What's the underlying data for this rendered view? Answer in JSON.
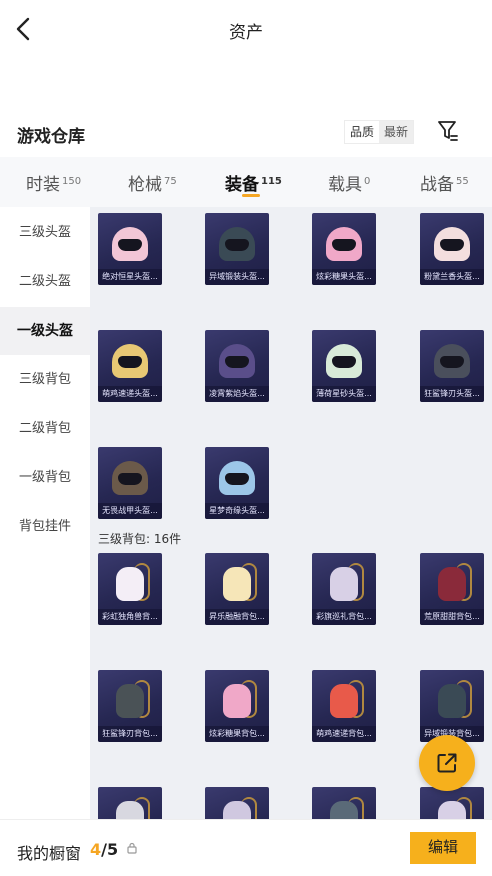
{
  "header": {
    "title": "资产"
  },
  "warehouse": {
    "title": "游戏仓库",
    "sort_options": [
      "品质",
      "最新"
    ]
  },
  "tabs": [
    {
      "label": "时装",
      "count": "150"
    },
    {
      "label": "枪械",
      "count": "75"
    },
    {
      "label": "装备",
      "count": "115"
    },
    {
      "label": "载具",
      "count": "0"
    },
    {
      "label": "战备",
      "count": "55"
    }
  ],
  "sidebar": [
    {
      "label": "三级头盔"
    },
    {
      "label": "二级头盔"
    },
    {
      "label": "一级头盔"
    },
    {
      "label": "三级背包"
    },
    {
      "label": "二级背包"
    },
    {
      "label": "一级背包"
    },
    {
      "label": "背包挂件"
    }
  ],
  "helmets": [
    {
      "name": "绝对恒星头盔...",
      "color": "#f2c6d6"
    },
    {
      "name": "异域锻装头盔...",
      "color": "#3a4a55"
    },
    {
      "name": "炫彩糖果头盔...",
      "color": "#f0a8c8"
    },
    {
      "name": "粉黛兰香头盔...",
      "color": "#f3dede"
    },
    {
      "name": "萌鸡速递头盔...",
      "color": "#e8c874"
    },
    {
      "name": "凌霄紫焰头盔...",
      "color": "#5a4e8a"
    },
    {
      "name": "薄荷星砂头盔...",
      "color": "#d8ead8"
    },
    {
      "name": "狂鲨锋刃头盔...",
      "color": "#4a4f5c"
    },
    {
      "name": "无畏战甲头盔...",
      "color": "#6b5a4a"
    },
    {
      "name": "星梦奇缘头盔...",
      "color": "#9cc6e8"
    }
  ],
  "backpack_section": {
    "label": "三级背包: 16件"
  },
  "backpacks": [
    {
      "name": "彩虹独角兽背...",
      "color": "#f4eef6"
    },
    {
      "name": "昇乐融融背包...",
      "color": "#f6e6b8"
    },
    {
      "name": "彩旗巡礼背包...",
      "color": "#d8d0e6"
    },
    {
      "name": "荒原甜甜背包...",
      "color": "#8a2a3a"
    },
    {
      "name": "狂鲨锋刃背包...",
      "color": "#4a5256"
    },
    {
      "name": "炫彩糖果背包...",
      "color": "#f0a8c8"
    },
    {
      "name": "萌鸡速递背包...",
      "color": "#e85a4a"
    },
    {
      "name": "异域锻装背包...",
      "color": "#3a4a55"
    },
    {
      "name": "",
      "color": "#d8d8e0"
    },
    {
      "name": "",
      "color": "#d0c8e0"
    },
    {
      "name": "",
      "color": "#5a6a78"
    },
    {
      "name": "",
      "color": "#d8d0e6"
    }
  ],
  "bottom": {
    "label": "我的橱窗",
    "count_current": "4",
    "count_sep": "/",
    "count_total": "5",
    "edit": "编辑"
  }
}
